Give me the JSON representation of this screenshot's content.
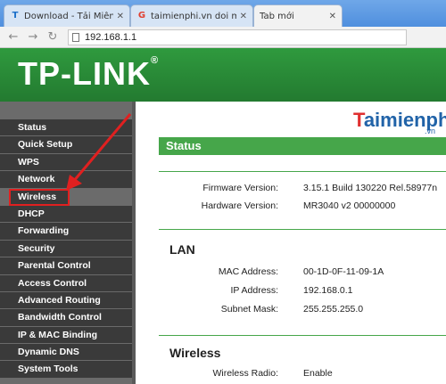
{
  "tabs": [
    {
      "icon": "T",
      "label": "Download - Tải Miễn Phí",
      "active": false
    },
    {
      "icon": "G",
      "label": "taimienphi.vn doi mat kh",
      "active": false
    },
    {
      "icon": "",
      "label": "Tab mới",
      "active": true
    }
  ],
  "address": {
    "url": "192.168.1.1"
  },
  "header": {
    "logo": "TP-LINK",
    "logo_mark": "®"
  },
  "sidebar": {
    "items": [
      "Status",
      "Quick Setup",
      "WPS",
      "Network",
      "Wireless",
      "DHCP",
      "Forwarding",
      "Security",
      "Parental Control",
      "Access Control",
      "Advanced Routing",
      "Bandwidth Control",
      "IP & MAC Binding",
      "Dynamic DNS",
      "System Tools"
    ],
    "highlighted_index": 4
  },
  "brand": {
    "first": "T",
    "rest": "aimienphi",
    "sub": ".vn"
  },
  "status": {
    "title": "Status",
    "firmware": {
      "label": "Firmware Version:",
      "value": "3.15.1 Build 130220 Rel.58977n"
    },
    "hardware": {
      "label": "Hardware Version:",
      "value": "MR3040 v2 00000000"
    }
  },
  "lan": {
    "title": "LAN",
    "mac": {
      "label": "MAC Address:",
      "value": "00-1D-0F-11-09-1A"
    },
    "ip": {
      "label": "IP Address:",
      "value": "192.168.0.1"
    },
    "mask": {
      "label": "Subnet Mask:",
      "value": "255.255.255.0"
    }
  },
  "wireless": {
    "title": "Wireless",
    "radio": {
      "label": "Wireless Radio:",
      "value": "Enable"
    }
  },
  "colors": {
    "green": "#46a64a",
    "header_green": "#2e8a3a",
    "sidebar": "#3a3a3a",
    "highlight_red": "#e02020"
  }
}
